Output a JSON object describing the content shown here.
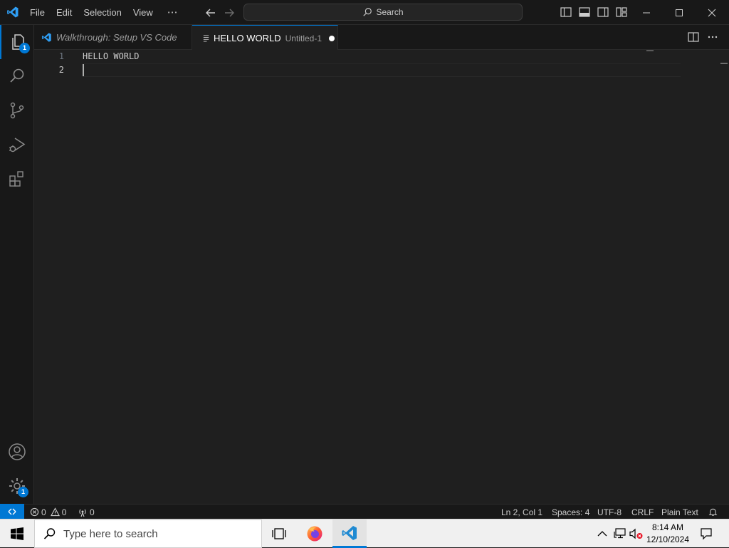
{
  "menu": [
    "File",
    "Edit",
    "Selection",
    "View",
    "⋯"
  ],
  "command_center": {
    "label": "Search"
  },
  "activity_bar": {
    "explorer_badge": "1",
    "manage_badge": "1"
  },
  "tabs": [
    {
      "label": "Walkthrough: Setup VS Code",
      "active": false
    },
    {
      "label": "HELLO WORLD",
      "description": "Untitled-1",
      "active": true,
      "dirty": true
    }
  ],
  "editor": {
    "lines": [
      {
        "number": "1",
        "text": "HELLO WORLD"
      },
      {
        "number": "2",
        "text": ""
      }
    ],
    "current_line": 2
  },
  "statusbar": {
    "errors": "0",
    "warnings": "0",
    "ports": "0",
    "position": "Ln 2, Col 1",
    "indent": "Spaces: 4",
    "encoding": "UTF-8",
    "eol": "CRLF",
    "language": "Plain Text"
  },
  "taskbar": {
    "search_placeholder": "Type here to search",
    "time": "8:14 AM",
    "date": "12/10/2024"
  },
  "colors": {
    "accent": "#0078d4",
    "editor_bg": "#1f1f1f",
    "chrome_bg": "#181818"
  }
}
